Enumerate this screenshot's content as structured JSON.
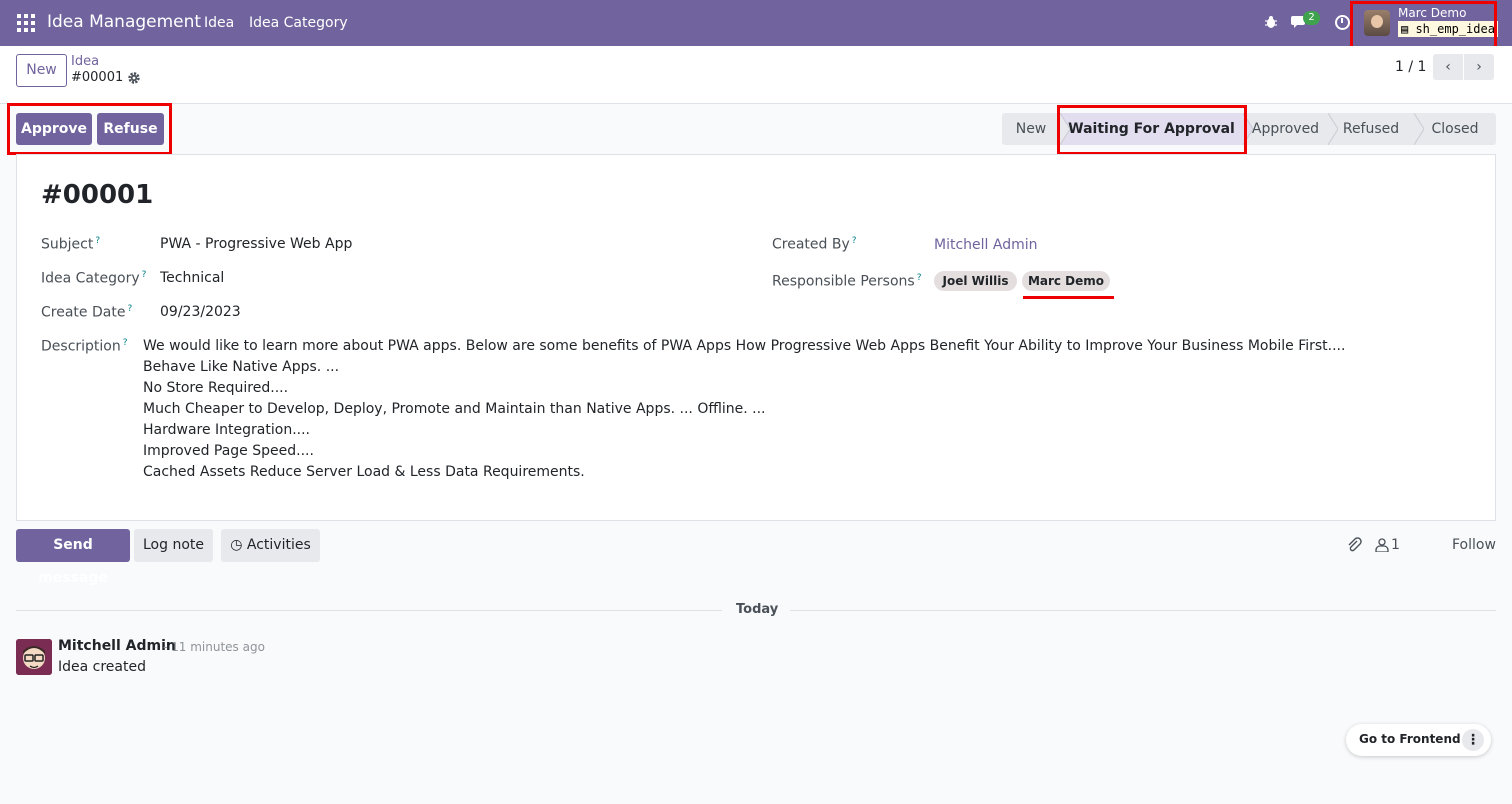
{
  "navbar": {
    "app_title": "Idea Management",
    "menu": [
      "Idea",
      "Idea Category"
    ],
    "chat_badge": "2",
    "user_name": "Marc Demo",
    "database": "sh_emp_idea",
    "color": "#71639e"
  },
  "control_panel": {
    "new_label": "New",
    "breadcrumb_parent": "Idea",
    "breadcrumb_current": "#00001",
    "pager": "1 / 1"
  },
  "actions": {
    "approve": "Approve",
    "refuse": "Refuse"
  },
  "stages": {
    "items": [
      "New",
      "Waiting For Approval",
      "Approved",
      "Refused",
      "Closed"
    ],
    "current": "Waiting For Approval"
  },
  "record": {
    "title": "#00001",
    "subject_label": "Subject",
    "subject": "PWA - Progressive Web App",
    "category_label": "Idea Category",
    "category": "Technical",
    "create_date_label": "Create Date",
    "create_date": "09/23/2023",
    "created_by_label": "Created By",
    "created_by": "Mitchell Admin",
    "responsible_label": "Responsible Persons",
    "responsible": [
      "Joel Willis",
      "Marc Demo"
    ],
    "description_label": "Description",
    "help_mark": "?",
    "description": [
      "We would like to learn more about PWA apps. Below are some benefits of PWA Apps How Progressive Web Apps Benefit Your Ability to Improve Your Business Mobile First....",
      "Behave Like Native Apps. ...",
      "No Store Required....",
      "Much Cheaper to Develop, Deploy, Promote and Maintain than Native Apps. ... Offline. ...",
      "Hardware Integration....",
      "Improved Page Speed....",
      "Cached Assets Reduce Server Load & Less Data Requirements."
    ]
  },
  "chatter": {
    "send_message": "Send message",
    "log_note": "Log note",
    "activities": "Activities",
    "follower_count": "1",
    "follow": "Follow",
    "date_separator": "Today",
    "messages": [
      {
        "author": "Mitchell Admin",
        "time": "- 11 minutes ago",
        "body": "Idea created"
      }
    ]
  },
  "frontend": {
    "label": "Go to Frontend"
  }
}
